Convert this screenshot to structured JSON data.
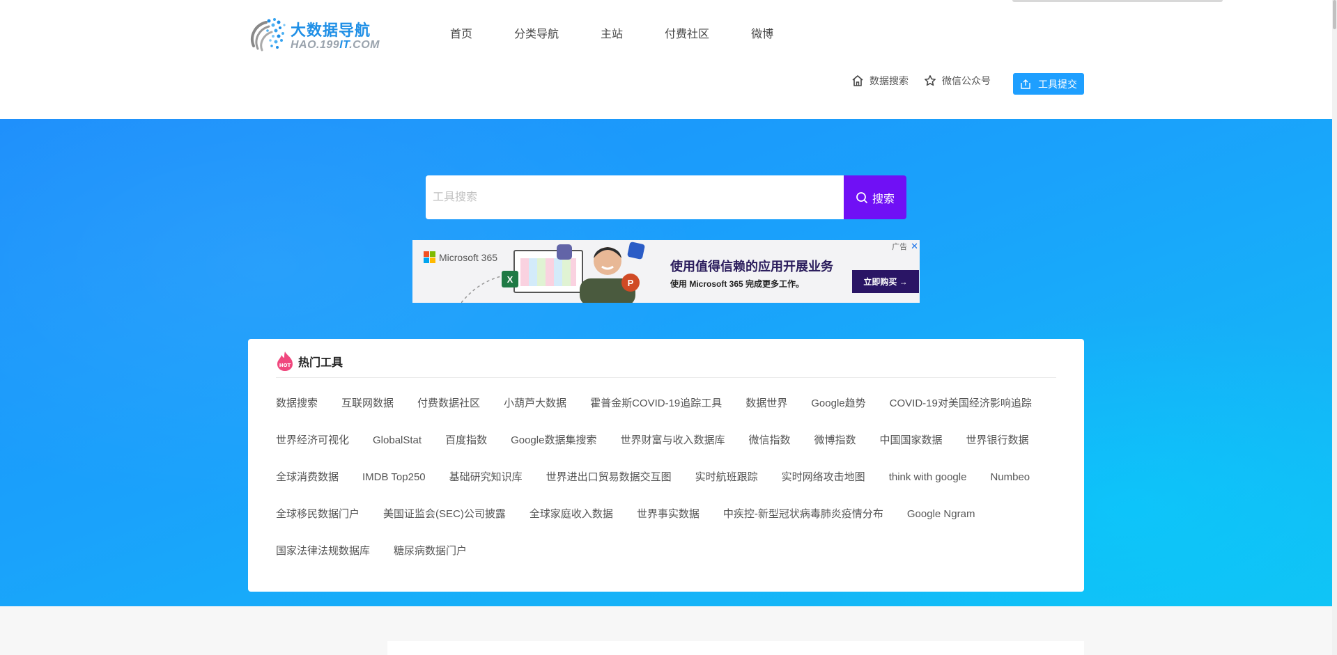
{
  "logo": {
    "title": "大数据导航",
    "sub_prefix": "HAO.199",
    "sub_accent": "IT",
    "sub_suffix": ".COM",
    "icon": "dots-globe-icon"
  },
  "nav": {
    "items": [
      {
        "label": "首页"
      },
      {
        "label": "分类导航"
      },
      {
        "label": "主站"
      },
      {
        "label": "付费社区"
      },
      {
        "label": "微博"
      }
    ]
  },
  "utility": {
    "data_search": {
      "label": "数据搜索",
      "icon": "home-icon"
    },
    "wechat": {
      "label": "微信公众号",
      "icon": "star-icon"
    },
    "submit": {
      "label": "工具提交",
      "icon": "upload-icon"
    }
  },
  "search": {
    "placeholder": "工具搜索",
    "value": "",
    "button_label": "搜索",
    "button_color": "#7010f5"
  },
  "ad": {
    "brand": "Microsoft 365",
    "headline": "使用值得信赖的应用开展业务",
    "subline": "使用 Microsoft 365 完成更多工作。",
    "cta": "立即购买 →",
    "badge": "广告",
    "close": "✕"
  },
  "hot_tools": {
    "title": "热门工具",
    "badge": "HOT",
    "items": [
      "数据搜索",
      "互联网数据",
      "付费数据社区",
      "小葫芦大数据",
      "霍普金斯COVID-19追踪工具",
      "数据世界",
      "Google趋势",
      "COVID-19对美国经济影响追踪",
      "世界经济可视化",
      "GlobalStat",
      "百度指数",
      "Google数据集搜索",
      "世界财富与收入数据库",
      "微信指数",
      "微博指数",
      "中国国家数据",
      "世界银行数据",
      "全球消费数据",
      "IMDB Top250",
      "基础研究知识库",
      "世界进出口贸易数据交互图",
      "实时航班跟踪",
      "实时网络攻击地图",
      "think with google",
      "Numbeo",
      "全球移民数据门户",
      "美国证监会(SEC)公司披露",
      "全球家庭收入数据",
      "世界事实数据",
      "中疾控-新型冠状病毒肺炎疫情分布",
      "Google Ngram",
      "国家法律法规数据库",
      "糖尿病数据门户"
    ]
  },
  "colors": {
    "brand_blue": "#1f8fe6",
    "submit_blue": "#1e9fff",
    "hero_start": "#1d8ffb",
    "hero_end": "#11c2f5"
  }
}
